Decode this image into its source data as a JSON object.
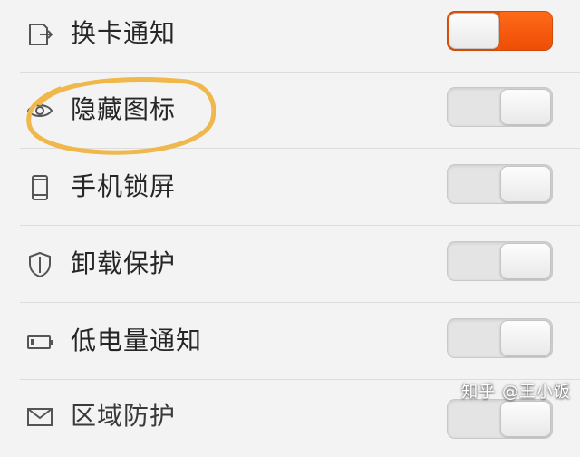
{
  "settings": {
    "items": [
      {
        "label": "换卡通知",
        "icon": "sim-change-icon",
        "enabled": true
      },
      {
        "label": "隐藏图标",
        "icon": "eye-icon",
        "enabled": false
      },
      {
        "label": "手机锁屏",
        "icon": "phone-icon",
        "enabled": false
      },
      {
        "label": "卸载保护",
        "icon": "shield-icon",
        "enabled": false
      },
      {
        "label": "低电量通知",
        "icon": "battery-low-icon",
        "enabled": false
      },
      {
        "label": "区域防护",
        "icon": "mail-icon",
        "enabled": false
      }
    ]
  },
  "annotation": {
    "color": "#f0b74a"
  },
  "colors": {
    "toggle_on": "#f15b0f",
    "toggle_off": "#e4e4e4",
    "background": "#f3f3f3"
  },
  "watermark": {
    "text": "知乎 @王小饭"
  }
}
